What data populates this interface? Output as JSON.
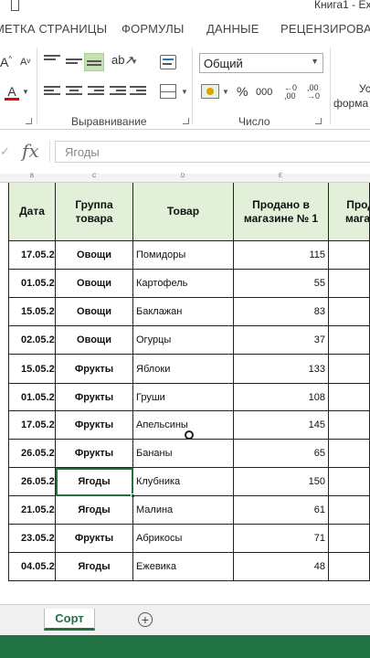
{
  "window": {
    "title": "Книга1 - Ex"
  },
  "ribbon": {
    "tabs": [
      "МЕТКА СТРАНИЦЫ",
      "ФОРМУЛЫ",
      "ДАННЫЕ",
      "РЕЦЕНЗИРОВАН"
    ],
    "groups": {
      "alignment": "Выравнивание",
      "number": "Число"
    },
    "number_format": "Общий",
    "percent": "%",
    "thousands": "000",
    "side_text_1": "Усл",
    "side_text_2": "форма",
    "accent_fill": "#c5e0b3",
    "font_color_bar": "#e00000"
  },
  "formula_bar": {
    "fx": "fx",
    "value": "Ягоды"
  },
  "columns": {
    "letters": [
      "B",
      "C",
      "D",
      "E"
    ],
    "headers": [
      "Дата",
      "Группа товара",
      "Товар",
      "Продано в магазине № 1",
      "Прод магаз"
    ]
  },
  "rows": [
    {
      "date": "17.05.25",
      "group": "Овощи",
      "item": "Помидоры",
      "sold": "115"
    },
    {
      "date": "01.05.25",
      "group": "Овощи",
      "item": "Картофель",
      "sold": "55"
    },
    {
      "date": "15.05.25",
      "group": "Овощи",
      "item": "Баклажан",
      "sold": "83"
    },
    {
      "date": "02.05.25",
      "group": "Овощи",
      "item": "Огурцы",
      "sold": "37"
    },
    {
      "date": "15.05.25",
      "group": "Фрукты",
      "item": "Яблоки",
      "sold": "133"
    },
    {
      "date": "01.05.25",
      "group": "Фрукты",
      "item": "Груши",
      "sold": "108"
    },
    {
      "date": "17.05.25",
      "group": "Фрукты",
      "item": "Апельсины",
      "sold": "145"
    },
    {
      "date": "26.05.25",
      "group": "Фрукты",
      "item": "Бананы",
      "sold": "65"
    },
    {
      "date": "26.05.25",
      "group": "Ягоды",
      "item": "Клубника",
      "sold": "150"
    },
    {
      "date": "21.05.25",
      "group": "Ягоды",
      "item": "Малина",
      "sold": "61"
    },
    {
      "date": "23.05.25",
      "group": "Фрукты",
      "item": "Абрикосы",
      "sold": "71"
    },
    {
      "date": "04.05.25",
      "group": "Ягоды",
      "item": "Ежевика",
      "sold": "48"
    }
  ],
  "active_row_index": 8,
  "sheets": {
    "active": "Сорт",
    "add_symbol": "+"
  },
  "colors": {
    "excel_green": "#217346",
    "header_fill": "#e2f0d9"
  }
}
